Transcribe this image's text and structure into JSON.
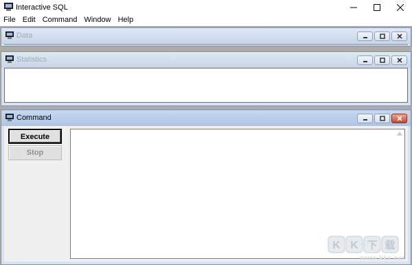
{
  "window": {
    "title": "Interactive SQL",
    "app_icon": "sql-app-icon",
    "caption_buttons": [
      "minimize-icon",
      "maximize-icon",
      "close-icon"
    ]
  },
  "menubar": {
    "items": [
      "File",
      "Edit",
      "Command",
      "Window",
      "Help"
    ]
  },
  "panels": {
    "data": {
      "title": "Data",
      "icon": "window-icon"
    },
    "statistics": {
      "title": "Statistics",
      "icon": "window-icon"
    },
    "command": {
      "title": "Command",
      "icon": "window-icon",
      "execute_label": "Execute",
      "stop_label": "Stop",
      "editor_text": ""
    }
  },
  "watermark": {
    "brand": "KK下载",
    "url": "www.kkx.net"
  },
  "colors": {
    "mdi_background": "#ababab",
    "child_frame": "#d6e2ef",
    "close_accent": "#c4472d"
  }
}
